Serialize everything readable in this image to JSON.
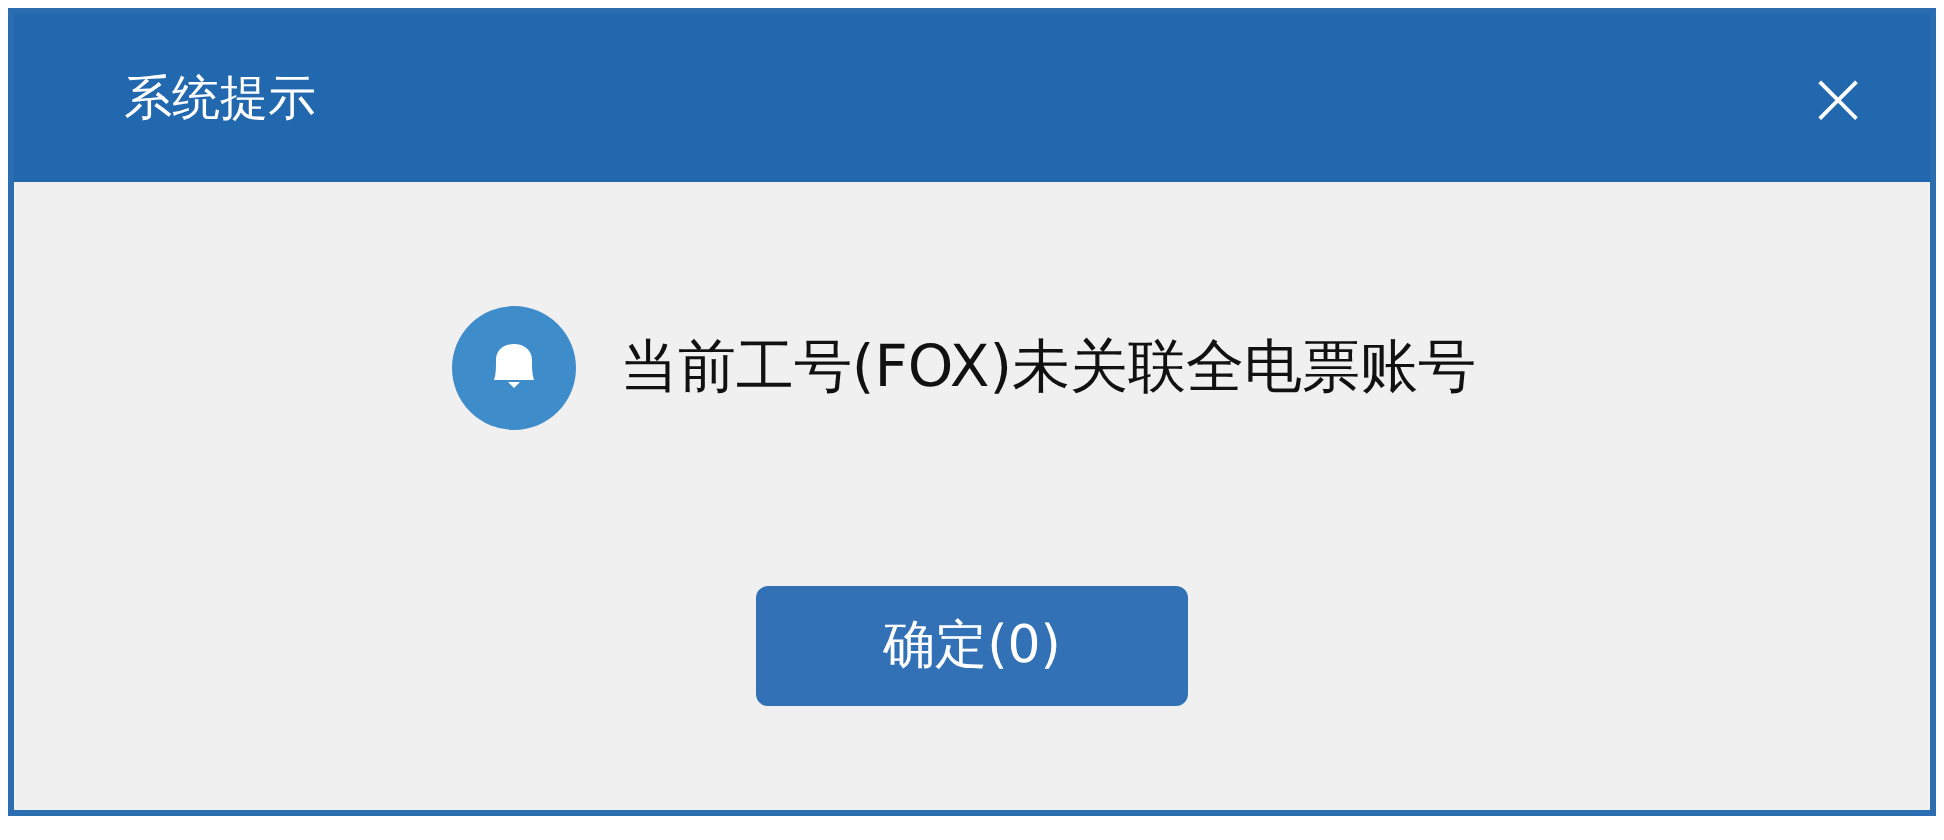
{
  "dialog": {
    "title": "系统提示",
    "close": "×",
    "message": "当前工号(FOX)未关联全电票账号",
    "button": "确定(0)"
  }
}
